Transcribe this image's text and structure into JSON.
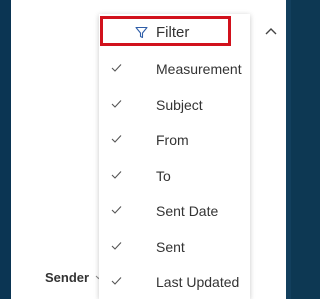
{
  "left_strip_color": "#0b3553",
  "panel_background": "#ffffff",
  "highlight_color": "#d1111c",
  "text_color": "#333333",
  "sender_column": {
    "label": "Sender",
    "chevron_icon": "chevron-down-icon"
  },
  "dropdown": {
    "filter": {
      "label": "Filter",
      "icon": "filter-funnel-icon"
    },
    "items": [
      {
        "label": "Measurement",
        "checked": true
      },
      {
        "label": "Subject",
        "checked": true
      },
      {
        "label": "From",
        "checked": true
      },
      {
        "label": "To",
        "checked": true
      },
      {
        "label": "Sent Date",
        "checked": true
      },
      {
        "label": "Sent",
        "checked": true
      },
      {
        "label": "Last Updated",
        "checked": true
      }
    ]
  },
  "scroll_up_icon": "chevron-up-icon"
}
